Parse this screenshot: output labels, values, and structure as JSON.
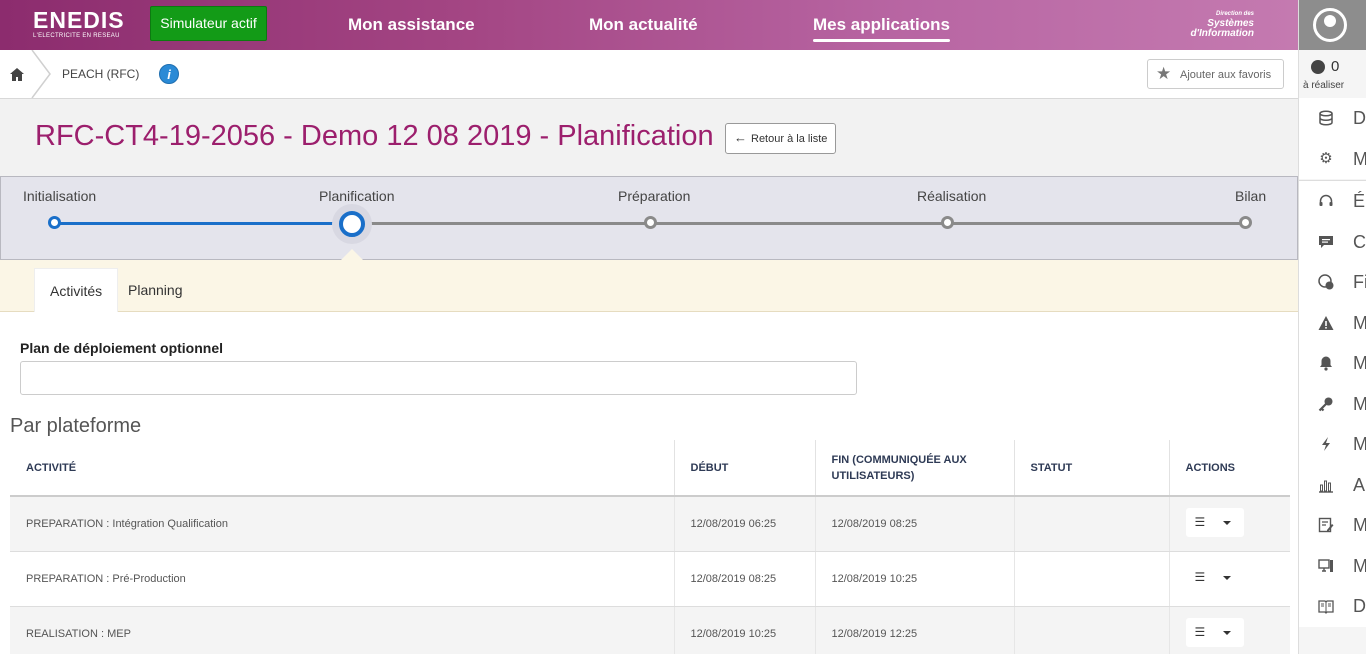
{
  "header": {
    "logo": "ENEDIS",
    "logo_sub": "L'ELECTRICITE EN RESEAU",
    "simulator_label": "Simulateur actif",
    "nav": [
      "Mon assistance",
      "Mon actualité",
      "Mes applications"
    ],
    "dsi_line1": "Direction des",
    "dsi_line2": "Systèmes",
    "dsi_line3": "d'Information"
  },
  "sidebar": {
    "todo_count": "0",
    "todo_label": "à réaliser",
    "items": [
      {
        "icon": "database-icon",
        "text": "D"
      },
      {
        "icon": "gear-icon",
        "text": "M"
      },
      {
        "icon": "headset-icon",
        "text": "É"
      },
      {
        "icon": "chat-icon",
        "text": "C"
      },
      {
        "icon": "support-24-icon",
        "text": "Fi"
      },
      {
        "icon": "warning-icon",
        "text": "M"
      },
      {
        "icon": "bell-icon",
        "text": "M"
      },
      {
        "icon": "key-icon",
        "text": "M"
      },
      {
        "icon": "bolt-icon",
        "text": "M"
      },
      {
        "icon": "bar-chart-icon",
        "text": "Aı"
      },
      {
        "icon": "edit-doc-icon",
        "text": "M"
      },
      {
        "icon": "workstation-icon",
        "text": "M"
      },
      {
        "icon": "book-icon",
        "text": "D"
      }
    ]
  },
  "breadcrumb": {
    "item": "PEACH (RFC)",
    "info": "i",
    "favorite_label": "Ajouter aux favoris"
  },
  "page": {
    "title": "RFC-CT4-19-2056 - Demo 12 08 2019 - Planification",
    "back_label": "Retour à la liste"
  },
  "stepper": {
    "steps": [
      "Initialisation",
      "Planification",
      "Préparation",
      "Réalisation",
      "Bilan"
    ],
    "current_index": 1
  },
  "tabs": [
    "Activités",
    "Planning"
  ],
  "form": {
    "label": "Plan de déploiement optionnel",
    "value": ""
  },
  "section_title": "Par plateforme",
  "table": {
    "headers": [
      "Activité",
      "Début",
      "Fin (communiquée aux utilisateurs)",
      "Statut",
      "Actions"
    ],
    "rows": [
      {
        "activite": "PREPARATION : Intégration Qualification",
        "debut": "12/08/2019 06:25",
        "fin": "12/08/2019 08:25",
        "statut": ""
      },
      {
        "activite": "PREPARATION : Pré-Production",
        "debut": "12/08/2019 08:25",
        "fin": "12/08/2019 10:25",
        "statut": ""
      },
      {
        "activite": "REALISATION : MEP",
        "debut": "12/08/2019 10:25",
        "fin": "12/08/2019 12:25",
        "statut": ""
      }
    ]
  },
  "colors": {
    "brand": "#9c1f6d",
    "simulator": "#139b17",
    "progress_done": "#1a6fc9",
    "progress_todo": "#8a8a8a"
  }
}
